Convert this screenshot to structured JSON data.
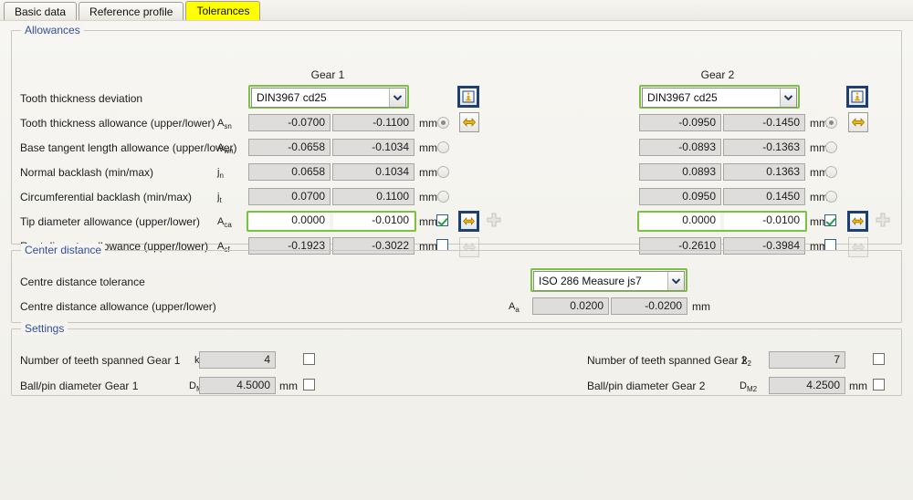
{
  "tabs": [
    {
      "label": "Basic data",
      "active": false
    },
    {
      "label": "Reference profile",
      "active": false
    },
    {
      "label": "Tolerances",
      "active": true
    }
  ],
  "groups": {
    "allowances": "Allowances",
    "center_distance": "Center distance",
    "settings": "Settings"
  },
  "columns": {
    "gear1": "Gear 1",
    "gear2": "Gear 2"
  },
  "allowances": {
    "deviation_label": "Tooth thickness deviation",
    "gear1_deviation": "DIN3967 cd25",
    "gear2_deviation": "DIN3967 cd25",
    "rows": [
      {
        "label": "Tooth thickness allowance (upper/lower)",
        "symbol": "A",
        "sub": "sn",
        "g1_upper": "-0.0700",
        "g1_lower": "-0.1100",
        "g2_upper": "-0.0950",
        "g2_lower": "-0.1450",
        "unit": "mm",
        "selector": "radio",
        "selected": true,
        "g1_editable": false,
        "g1_highlight": false,
        "g2_editable": false,
        "g2_highlight": false,
        "swap_enabled": true,
        "has_plus": false
      },
      {
        "label": "Base tangent length allowance (upper/lower)",
        "symbol": "A",
        "sub": "wn",
        "g1_upper": "-0.0658",
        "g1_lower": "-0.1034",
        "g2_upper": "-0.0893",
        "g2_lower": "-0.1363",
        "unit": "mm",
        "selector": "radio",
        "selected": false,
        "g1_editable": false,
        "g1_highlight": false,
        "g2_editable": false,
        "g2_highlight": false,
        "swap_enabled": false,
        "has_plus": false
      },
      {
        "label": "Normal backlash (min/max)",
        "symbol": "j",
        "sub": "n",
        "g1_upper": "0.0658",
        "g1_lower": "0.1034",
        "g2_upper": "0.0893",
        "g2_lower": "0.1363",
        "unit": "mm",
        "selector": "radio",
        "selected": false,
        "g1_editable": false,
        "g1_highlight": false,
        "g2_editable": false,
        "g2_highlight": false,
        "swap_enabled": false,
        "has_plus": false
      },
      {
        "label": "Circumferential backlash (min/max)",
        "symbol": "j",
        "sub": "t",
        "g1_upper": "0.0700",
        "g1_lower": "0.1100",
        "g2_upper": "0.0950",
        "g2_lower": "0.1450",
        "unit": "mm",
        "selector": "radio",
        "selected": false,
        "g1_editable": false,
        "g1_highlight": false,
        "g2_editable": false,
        "g2_highlight": false,
        "swap_enabled": false,
        "has_plus": false
      },
      {
        "label": "Tip diameter allowance (upper/lower)",
        "symbol": "A",
        "sub": "ca",
        "g1_upper": "0.0000",
        "g1_lower": "-0.0100",
        "g2_upper": "0.0000",
        "g2_lower": "-0.0100",
        "unit": "mm",
        "selector": "checkbox",
        "selected": true,
        "g1_editable": true,
        "g1_highlight": true,
        "g2_editable": true,
        "g2_highlight": true,
        "swap_enabled": true,
        "has_plus": true
      },
      {
        "label": "Root diameter allowance (upper/lower)",
        "symbol": "A",
        "sub": "cf",
        "g1_upper": "-0.1923",
        "g1_lower": "-0.3022",
        "g2_upper": "-0.2610",
        "g2_lower": "-0.3984",
        "unit": "mm",
        "selector": "checkbox",
        "selected": false,
        "g1_editable": false,
        "g1_highlight": false,
        "g2_editable": false,
        "g2_highlight": false,
        "swap_enabled": false,
        "has_plus": false
      }
    ],
    "info_icon": "info-icon",
    "swap_icon": "swap-arrows-icon",
    "plus_icon": "plus-icon"
  },
  "center_distance": {
    "tolerance_label": "Centre distance tolerance",
    "tolerance_value": "ISO 286 Measure js7",
    "allowance_label": "Centre distance allowance (upper/lower)",
    "allowance_symbol": "A",
    "allowance_sub": "a",
    "allowance_upper": "0.0200",
    "allowance_lower": "-0.0200",
    "unit": "mm"
  },
  "settings": {
    "teeth_gear1_label": "Number of teeth spanned Gear 1",
    "teeth_gear1_symbol": "k",
    "teeth_gear1_sub": "1",
    "teeth_gear1_value": "4",
    "teeth_gear1_checked": false,
    "ball_gear1_label": "Ball/pin diameter Gear 1",
    "ball_gear1_symbol": "D",
    "ball_gear1_sub": "M1",
    "ball_gear1_value": "4.5000",
    "ball_gear1_unit": "mm",
    "ball_gear1_checked": false,
    "teeth_gear2_label": "Number of teeth spanned Gear 2",
    "teeth_gear2_symbol": "k",
    "teeth_gear2_sub": "2",
    "teeth_gear2_value": "7",
    "teeth_gear2_checked": false,
    "ball_gear2_label": "Ball/pin diameter Gear 2",
    "ball_gear2_symbol": "D",
    "ball_gear2_sub": "M2",
    "ball_gear2_value": "4.2500",
    "ball_gear2_unit": "mm",
    "ball_gear2_checked": false
  },
  "colors": {
    "highlight_green": "#7cc242",
    "active_tab": "#ffff00",
    "legend_blue": "#2f4f9e",
    "icon_frame_blue": "#1f3f73"
  }
}
